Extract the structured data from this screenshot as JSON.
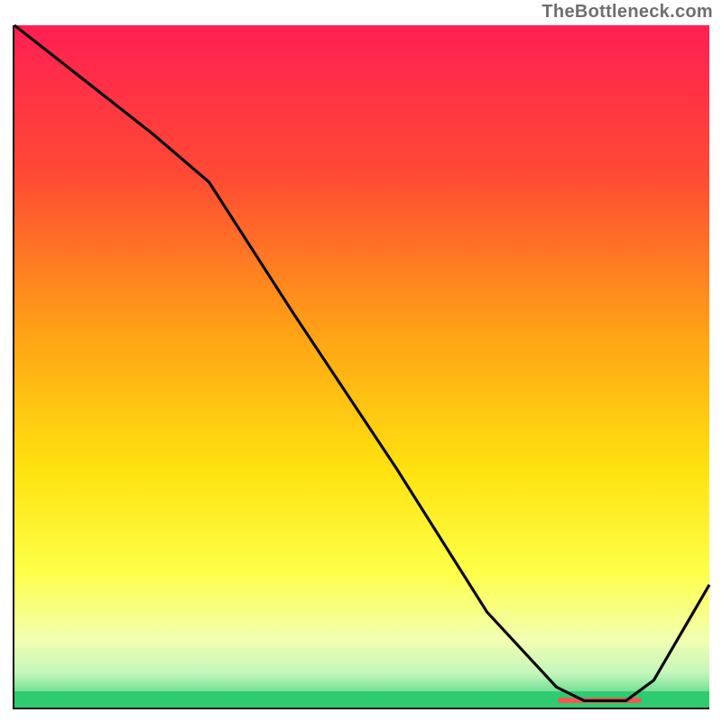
{
  "watermark": "TheBottleneck.com",
  "chart_data": {
    "type": "line",
    "title": "",
    "xlabel": "",
    "ylabel": "",
    "xlim": [
      0,
      100
    ],
    "ylim": [
      0,
      100
    ],
    "series": [
      {
        "name": "bottleneck-curve",
        "x": [
          0,
          10,
          20,
          28,
          40,
          55,
          68,
          78,
          82,
          88,
          92,
          100
        ],
        "y": [
          100,
          92,
          84,
          77,
          58,
          35,
          14,
          3,
          1,
          1,
          4,
          18
        ]
      }
    ],
    "flat_segment": {
      "x_start": 78,
      "x_end": 90,
      "y": 1
    },
    "gradient_stops": [
      {
        "pct": 0,
        "color": "#ff1f52"
      },
      {
        "pct": 22,
        "color": "#ff4a34"
      },
      {
        "pct": 45,
        "color": "#ffa215"
      },
      {
        "pct": 65,
        "color": "#ffe20f"
      },
      {
        "pct": 80,
        "color": "#feff47"
      },
      {
        "pct": 90,
        "color": "#f2ffb0"
      },
      {
        "pct": 95,
        "color": "#c3f6bb"
      },
      {
        "pct": 100,
        "color": "#2ecb71"
      }
    ]
  }
}
